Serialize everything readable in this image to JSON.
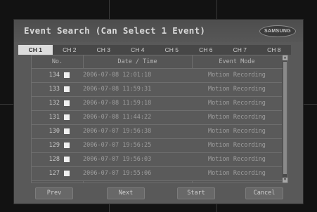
{
  "dialog": {
    "title": "Event Search (Can Select 1 Event)",
    "logo_text": "SAMSUNG"
  },
  "tabs": [
    {
      "label": "CH 1",
      "active": true
    },
    {
      "label": "CH 2",
      "active": false
    },
    {
      "label": "CH 3",
      "active": false
    },
    {
      "label": "CH 4",
      "active": false
    },
    {
      "label": "CH 5",
      "active": false
    },
    {
      "label": "CH 6",
      "active": false
    },
    {
      "label": "CH 7",
      "active": false
    },
    {
      "label": "CH 8",
      "active": false
    }
  ],
  "table": {
    "headers": {
      "no": "No.",
      "datetime": "Date / Time",
      "mode": "Event Mode"
    },
    "rows": [
      {
        "no": "134",
        "datetime": "2006-07-08 12:01:18",
        "mode": "Motion Recording"
      },
      {
        "no": "133",
        "datetime": "2006-07-08 11:59:31",
        "mode": "Motion Recording"
      },
      {
        "no": "132",
        "datetime": "2006-07-08 11:59:18",
        "mode": "Motion Recording"
      },
      {
        "no": "131",
        "datetime": "2006-07-08 11:44:22",
        "mode": "Motion Recording"
      },
      {
        "no": "130",
        "datetime": "2006-07-07 19:56:38",
        "mode": "Motion Recording"
      },
      {
        "no": "129",
        "datetime": "2006-07-07 19:56:25",
        "mode": "Motion Recording"
      },
      {
        "no": "128",
        "datetime": "2006-07-07 19:56:03",
        "mode": "Motion Recording"
      },
      {
        "no": "127",
        "datetime": "2006-07-07 19:55:06",
        "mode": "Motion Recording"
      }
    ]
  },
  "buttons": {
    "prev": "Prev",
    "next": "Next",
    "start": "Start",
    "cancel": "Cancel"
  },
  "colors": {
    "background": "#121212",
    "dialog": "#595959",
    "active_tab": "#dcdcdc",
    "checkbox": "#f0f0f0"
  },
  "icons": [
    "scroll-up-arrow-icon",
    "scroll-down-arrow-icon",
    "samsung-logo-icon"
  ]
}
